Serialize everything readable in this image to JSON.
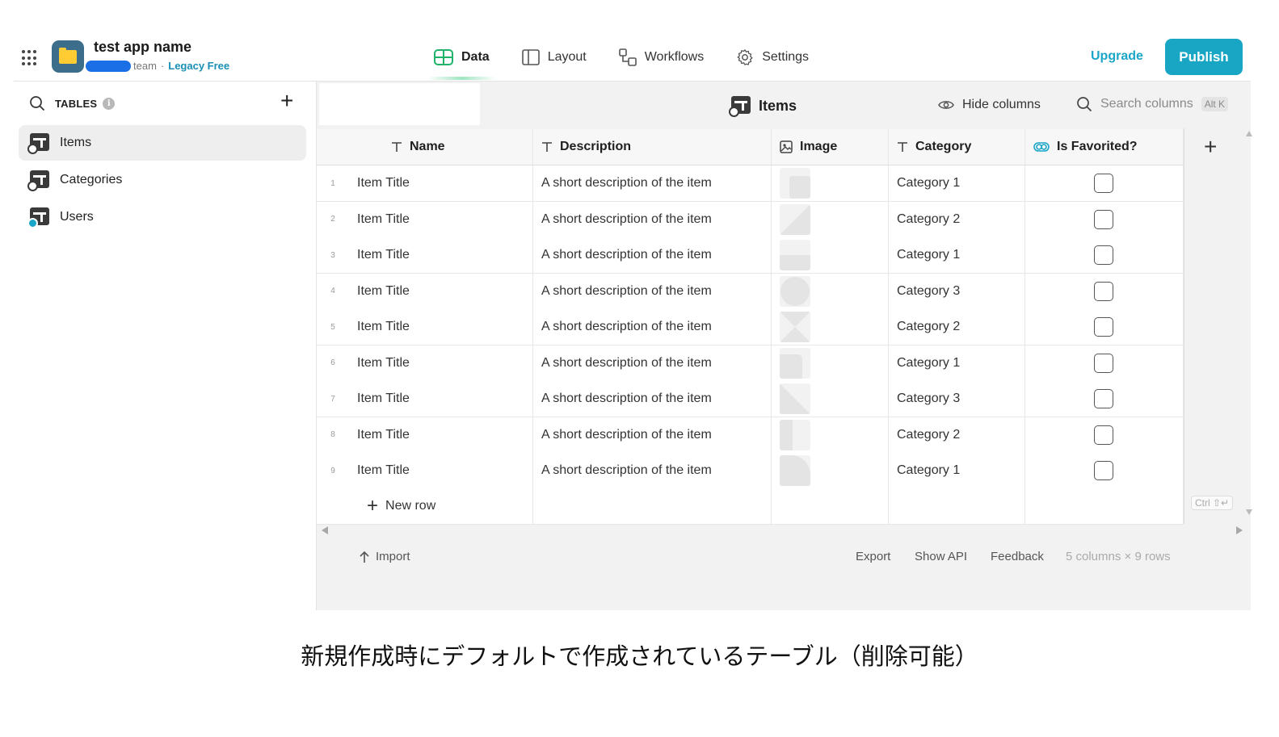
{
  "app": {
    "name": "test app name",
    "team": "team",
    "separator": "·",
    "plan": "Legacy Free"
  },
  "nav": {
    "tabs": [
      {
        "label": "Data",
        "icon": "data-grid-icon",
        "active": true
      },
      {
        "label": "Layout",
        "icon": "layout-icon",
        "active": false
      },
      {
        "label": "Workflows",
        "icon": "workflows-icon",
        "active": false
      },
      {
        "label": "Settings",
        "icon": "gear-icon",
        "active": false
      }
    ],
    "upgrade_label": "Upgrade",
    "publish_label": "Publish"
  },
  "sidebar": {
    "section_label": "TABLES",
    "info_glyph": "i",
    "add_glyph": "+",
    "items": [
      {
        "label": "Items",
        "active": true
      },
      {
        "label": "Categories",
        "active": false
      },
      {
        "label": "Users",
        "active": false
      }
    ]
  },
  "table": {
    "title": "Items",
    "hide_columns_label": "Hide columns",
    "search_placeholder": "Search columns",
    "search_shortcut": "Alt K",
    "add_column_glyph": "+",
    "columns": [
      {
        "label": "Name",
        "type": "text"
      },
      {
        "label": "Description",
        "type": "text"
      },
      {
        "label": "Image",
        "type": "image"
      },
      {
        "label": "Category",
        "type": "text"
      },
      {
        "label": "Is Favorited?",
        "type": "boolean"
      }
    ],
    "rows": [
      {
        "num": "1",
        "name": "Item Title",
        "description": "A short description of the item",
        "category": "Category 1",
        "favorited": false
      },
      {
        "num": "2",
        "name": "Item Title",
        "description": "A short description of the item",
        "category": "Category 2",
        "favorited": false
      },
      {
        "num": "3",
        "name": "Item Title",
        "description": "A short description of the item",
        "category": "Category 1",
        "favorited": false
      },
      {
        "num": "4",
        "name": "Item Title",
        "description": "A short description of the item",
        "category": "Category 3",
        "favorited": false
      },
      {
        "num": "5",
        "name": "Item Title",
        "description": "A short description of the item",
        "category": "Category 2",
        "favorited": false
      },
      {
        "num": "6",
        "name": "Item Title",
        "description": "A short description of the item",
        "category": "Category 1",
        "favorited": false
      },
      {
        "num": "7",
        "name": "Item Title",
        "description": "A short description of the item",
        "category": "Category 3",
        "favorited": false
      },
      {
        "num": "8",
        "name": "Item Title",
        "description": "A short description of the item",
        "category": "Category 2",
        "favorited": false
      },
      {
        "num": "9",
        "name": "Item Title",
        "description": "A short description of the item",
        "category": "Category 1",
        "favorited": false
      }
    ],
    "new_row_glyph": "+",
    "new_row_label": "New row",
    "new_row_shortcut": "Ctrl ⇧↵"
  },
  "footer": {
    "import_label": "Import",
    "export_label": "Export",
    "show_api_label": "Show API",
    "feedback_label": "Feedback",
    "count_text": "5 columns × 9 rows"
  },
  "caption": "新規作成時にデフォルトで作成されているテーブル（削除可能）",
  "colors": {
    "accent": "#18a6c4",
    "team_pill": "#1a6fe6",
    "active_tab_glow": "#2ec478",
    "app_logo_bg": "#3c6e8c",
    "folder": "#ffcc33"
  }
}
